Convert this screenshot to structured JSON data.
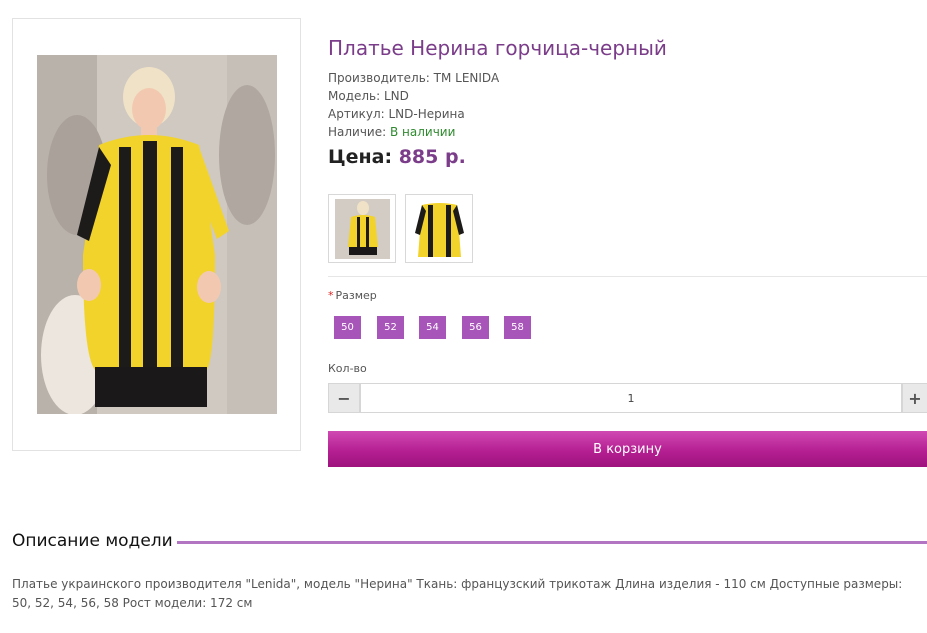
{
  "product": {
    "title": "Платье Нерина горчица-черный",
    "manufacturer": "Производитель: TM LENIDA",
    "model": "Модель: LND",
    "sku": "Артикул: LND-Нерина",
    "availability_label": "Наличие: ",
    "availability_value": "В наличии",
    "price_label": "Цена: ",
    "price_value": "885 р."
  },
  "options": {
    "size_label": "Размер",
    "required_mark": "*",
    "sizes": [
      "50",
      "52",
      "54",
      "56",
      "58"
    ],
    "qty_label": "Кол-во",
    "qty_value": "1",
    "minus_icon": "minus-icon",
    "plus_icon": "plus-icon"
  },
  "cart": {
    "button_label": "В корзину"
  },
  "description": {
    "heading": "Описание модели",
    "text": "Платье украинского производителя \"Lenida\", модель \"Нерина\" Ткань: французский трикотаж Длина изделия - 110 см Доступные размеры: 50, 52, 54, 56, 58 Рост модели: 172 см"
  },
  "colors": {
    "accent": "#7b3d8a",
    "size_button": "#a755b8",
    "cart_button": "#b51f92",
    "in_stock": "#2f8a2f"
  }
}
